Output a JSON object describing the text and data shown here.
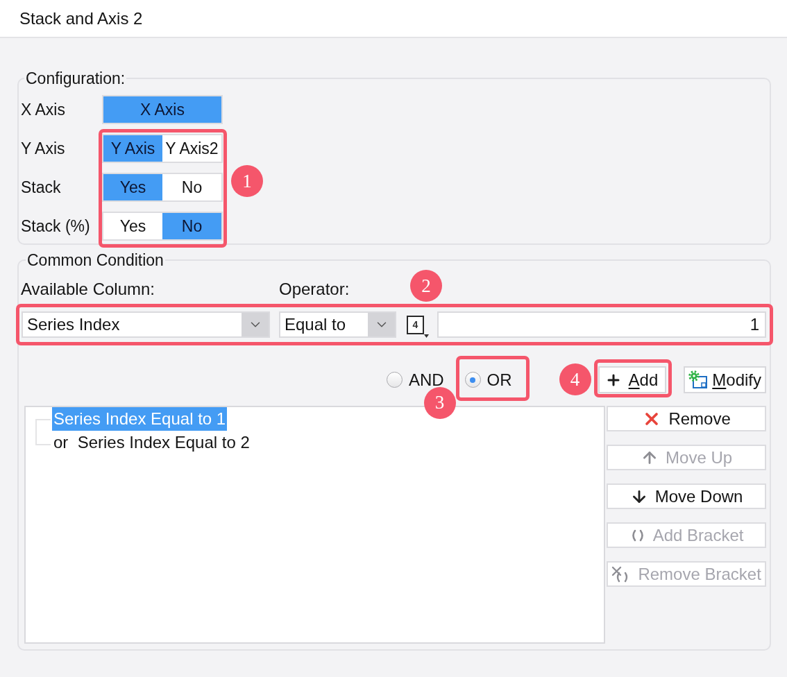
{
  "window": {
    "title": "Stack and Axis 2"
  },
  "configuration": {
    "legend": "Configuration:",
    "callout": "1",
    "rows": [
      {
        "label": "X Axis",
        "highlighted": false,
        "options": [
          {
            "label": "X Axis",
            "selected": true
          }
        ]
      },
      {
        "label": "Y Axis",
        "highlighted": true,
        "options": [
          {
            "label": "Y Axis",
            "selected": true
          },
          {
            "label": "Y Axis2",
            "selected": false
          }
        ]
      },
      {
        "label": "Stack",
        "highlighted": true,
        "options": [
          {
            "label": "Yes",
            "selected": true
          },
          {
            "label": "No",
            "selected": false
          }
        ]
      },
      {
        "label": "Stack (%)",
        "highlighted": true,
        "options": [
          {
            "label": "Yes",
            "selected": false
          },
          {
            "label": "No",
            "selected": true
          }
        ]
      }
    ]
  },
  "common_condition": {
    "legend": "Common Condition",
    "column_label": "Available Column:",
    "operator_label": "Operator:",
    "condition_row": {
      "callout": "2",
      "column": "Series Index",
      "operator": "Equal to",
      "value_type": "4",
      "value": "1"
    },
    "logic": [
      {
        "label": "AND",
        "selected": false
      },
      {
        "label": "OR",
        "selected": true,
        "callout": "3"
      }
    ],
    "action_buttons": [
      {
        "kind": "add",
        "label": "Add",
        "mnemonic_underlined": true,
        "callout": "4"
      },
      {
        "kind": "modify",
        "label": "Modify",
        "mnemonic_underlined": true
      }
    ],
    "conditions": [
      {
        "text": "Series Index Equal to 1",
        "selected": true
      },
      {
        "text": "or  Series Index Equal to 2",
        "selected": false
      }
    ],
    "list_buttons": [
      {
        "kind": "remove",
        "label": "Remove",
        "disabled": false
      },
      {
        "kind": "move_up",
        "label": "Move Up",
        "disabled": true
      },
      {
        "kind": "move_down",
        "label": "Move Down",
        "disabled": false
      },
      {
        "kind": "add_bracket",
        "label": "Add Bracket",
        "disabled": true
      },
      {
        "kind": "remove_bracket",
        "label": "Remove Bracket",
        "disabled": true
      }
    ]
  }
}
